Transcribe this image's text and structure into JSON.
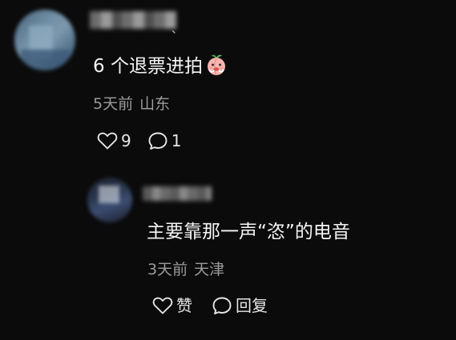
{
  "comments": [
    {
      "text": "6 个退票进拍",
      "emoji": "peach-emoji",
      "time": "5天前",
      "location": "山东",
      "likes": "9",
      "replies": "1"
    },
    {
      "text": "主要靠那一声“恣”的电音",
      "time": "3天前",
      "location": "天津",
      "like_label": "赞",
      "reply_label": "回复"
    }
  ],
  "username_suffix": "、",
  "colors": {
    "background": "#0b0b0c",
    "text_primary": "#f5f5f5",
    "text_secondary": "#9b9b9b"
  }
}
